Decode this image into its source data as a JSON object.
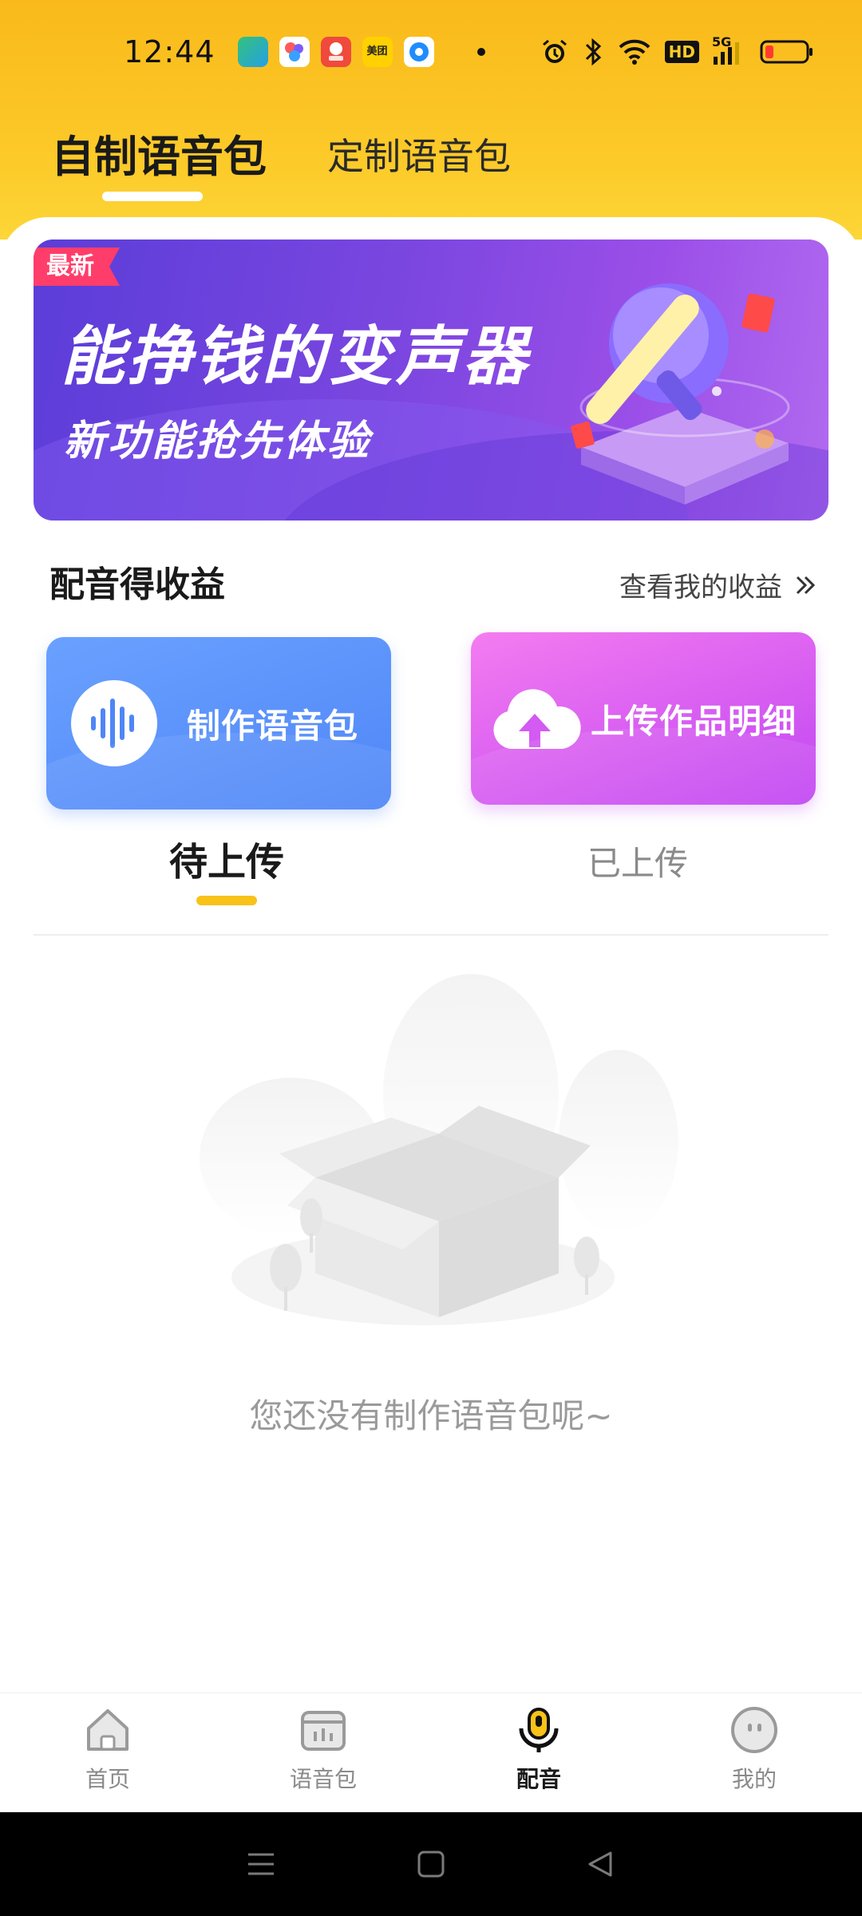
{
  "status_bar": {
    "time": "12:44",
    "app_icons": [
      "green-app-icon",
      "multicolor-app-icon",
      "red-app-icon",
      "meituan-app-icon",
      "blue-circle-app-icon"
    ],
    "meituan_label": "美团",
    "right_icons": [
      "alarm-icon",
      "bluetooth-icon",
      "wifi-icon",
      "hd-icon",
      "5g-signal-icon",
      "battery-low-icon"
    ],
    "hd_label": "HD",
    "network_label": "5G"
  },
  "top_tabs": {
    "active": "自制语音包",
    "other": "定制语音包"
  },
  "banner": {
    "badge": "最新",
    "title": "能挣钱的变声器",
    "subtitle": "新功能抢先体验"
  },
  "earnings": {
    "title": "配音得收益",
    "link": "查看我的收益"
  },
  "cards": {
    "make": "制作语音包",
    "upload": "上传作品明细"
  },
  "sub_tabs": {
    "active": "待上传",
    "other": "已上传"
  },
  "empty": {
    "text": "您还没有制作语音包呢~"
  },
  "bottom_nav": {
    "items": [
      {
        "label": "首页",
        "icon": "home-icon"
      },
      {
        "label": "语音包",
        "icon": "voice-pack-icon"
      },
      {
        "label": "配音",
        "icon": "microphone-icon"
      },
      {
        "label": "我的",
        "icon": "profile-icon"
      }
    ],
    "active_index": 2
  },
  "colors": {
    "header_yellow": "#fccb2a",
    "accent_yellow": "#f8c218",
    "card_blue": "#4f86f7",
    "card_pink": "#c146f2",
    "banner_purple": "#6b42dc"
  }
}
